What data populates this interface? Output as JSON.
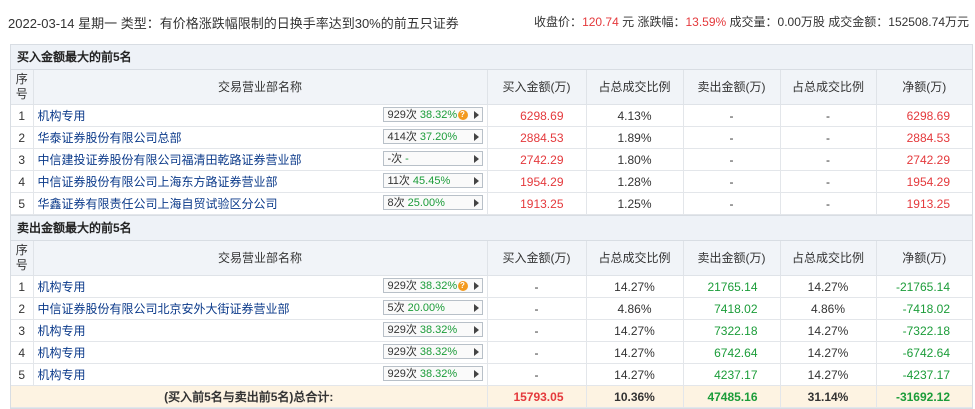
{
  "header": {
    "info": "2022-03-14 星期一 类型：有价格涨跌幅限制的日换手率达到30%的前五只证券",
    "close_label": "收盘价：",
    "close_value": "120.74",
    "close_unit": "元",
    "change_label": "涨跌幅：",
    "change_value": "13.59%",
    "volume_label": "成交量：",
    "volume_value": "0.00万股",
    "amount_label": "成交金额：",
    "amount_value": "152508.74万元"
  },
  "columns": {
    "seq": "序号",
    "name": "交易营业部名称",
    "buy": "买入金额(万)",
    "buy_ratio": "占总成交比例",
    "sell": "卖出金额(万)",
    "sell_ratio": "占总成交比例",
    "net": "净额(万)"
  },
  "buy_section": {
    "title": "买入金额最大的前5名",
    "rows": [
      {
        "seq": "1",
        "name": "机构专用",
        "times": "929次",
        "pct": "38.32%",
        "has_q": true,
        "buy": "6298.69",
        "buy_ratio": "4.13%",
        "sell": "-",
        "sell_ratio": "-",
        "net": "6298.69"
      },
      {
        "seq": "2",
        "name": "华泰证券股份有限公司总部",
        "times": "414次",
        "pct": "37.20%",
        "has_q": false,
        "buy": "2884.53",
        "buy_ratio": "1.89%",
        "sell": "-",
        "sell_ratio": "-",
        "net": "2884.53"
      },
      {
        "seq": "3",
        "name": "中信建投证券股份有限公司福清田乾路证券营业部",
        "times": "-次",
        "pct": "-",
        "has_q": false,
        "buy": "2742.29",
        "buy_ratio": "1.80%",
        "sell": "-",
        "sell_ratio": "-",
        "net": "2742.29"
      },
      {
        "seq": "4",
        "name": "中信证券股份有限公司上海东方路证券营业部",
        "times": "11次",
        "pct": "45.45%",
        "has_q": false,
        "buy": "1954.29",
        "buy_ratio": "1.28%",
        "sell": "-",
        "sell_ratio": "-",
        "net": "1954.29"
      },
      {
        "seq": "5",
        "name": "华鑫证券有限责任公司上海自贸试验区分公司",
        "times": "8次",
        "pct": "25.00%",
        "has_q": false,
        "buy": "1913.25",
        "buy_ratio": "1.25%",
        "sell": "-",
        "sell_ratio": "-",
        "net": "1913.25"
      }
    ]
  },
  "sell_section": {
    "title": "卖出金额最大的前5名",
    "rows": [
      {
        "seq": "1",
        "name": "机构专用",
        "times": "929次",
        "pct": "38.32%",
        "has_q": true,
        "buy": "-",
        "buy_ratio": "14.27%",
        "sell": "21765.14",
        "sell_ratio": "14.27%",
        "net": "-21765.14"
      },
      {
        "seq": "2",
        "name": "中信证券股份有限公司北京安外大街证券营业部",
        "times": "5次",
        "pct": "20.00%",
        "has_q": false,
        "buy": "-",
        "buy_ratio": "4.86%",
        "sell": "7418.02",
        "sell_ratio": "4.86%",
        "net": "-7418.02"
      },
      {
        "seq": "3",
        "name": "机构专用",
        "times": "929次",
        "pct": "38.32%",
        "has_q": false,
        "buy": "-",
        "buy_ratio": "14.27%",
        "sell": "7322.18",
        "sell_ratio": "14.27%",
        "net": "-7322.18"
      },
      {
        "seq": "4",
        "name": "机构专用",
        "times": "929次",
        "pct": "38.32%",
        "has_q": false,
        "buy": "-",
        "buy_ratio": "14.27%",
        "sell": "6742.64",
        "sell_ratio": "14.27%",
        "net": "-6742.64"
      },
      {
        "seq": "5",
        "name": "机构专用",
        "times": "929次",
        "pct": "38.32%",
        "has_q": false,
        "buy": "-",
        "buy_ratio": "14.27%",
        "sell": "4237.17",
        "sell_ratio": "14.27%",
        "net": "-4237.17"
      }
    ]
  },
  "total": {
    "label_prefix": "(买入前5名与卖出前5名)",
    "label_bold": "总合计:",
    "buy": "15793.05",
    "buy_ratio": "10.36%",
    "sell": "47485.16",
    "sell_ratio": "31.14%",
    "net": "-31692.12"
  },
  "colors": {
    "up": "#e4393c",
    "down": "#1b9c39",
    "link": "#0b3a8a"
  }
}
